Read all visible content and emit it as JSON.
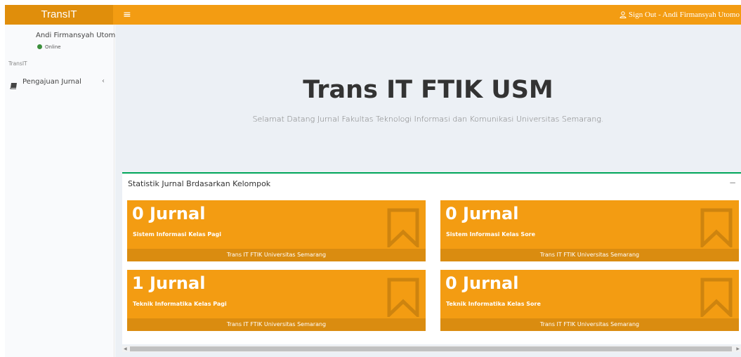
{
  "header": {
    "brand": "TransIT",
    "menu_toggle": "≡",
    "signout": "Sign Out - Andi Firmansyah Utomo"
  },
  "sidebar": {
    "user_name": "Andi Firmansyah Utomo",
    "status": "Online",
    "section_header": "TransIT",
    "items": [
      {
        "label": "Pengajuan Jurnal",
        "icon": "book-icon",
        "chevron": "‹"
      }
    ]
  },
  "hero": {
    "title": "Trans IT FTIK USM",
    "subtitle": "Selamat Datang Jurnal Fakultas Teknologi Informasi dan Komunikasi Universitas Semarang."
  },
  "stats_box": {
    "title": "Statistik Jurnal Brdasarkan Kelompok",
    "collapse": "−",
    "cards": [
      {
        "count": "0 Jurnal",
        "desc": "Sistem Informasi Kelas Pagi",
        "footer": "Trans IT FTIK Universitas Semarang"
      },
      {
        "count": "0 Jurnal",
        "desc": "Sistem Informasi Kelas Sore",
        "footer": "Trans IT FTIK Universitas Semarang"
      },
      {
        "count": "1 Jurnal",
        "desc": "Teknik Informatika Kelas Pagi",
        "footer": "Trans IT FTIK Universitas Semarang"
      },
      {
        "count": "0 Jurnal",
        "desc": "Teknik Informatika Kelas Sore",
        "footer": "Trans IT FTIK Universitas Semarang"
      }
    ]
  },
  "colors": {
    "header": "#f39c12",
    "brand_bg": "#e08e0b",
    "card": "#f39c12",
    "card_footer": "#da8c10",
    "box_border": "#00a65a",
    "content_bg": "#ecf0f5"
  }
}
